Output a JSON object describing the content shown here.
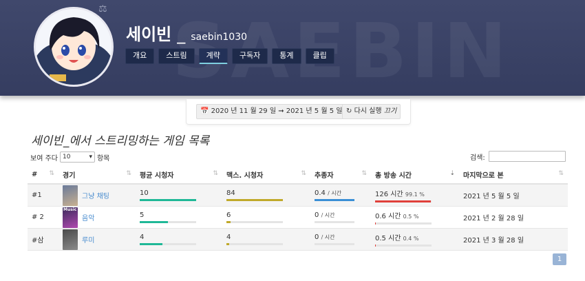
{
  "header": {
    "bg_watermark": "SAEBIN",
    "display_name": "세이빈",
    "separator": "_",
    "login": "saebin1030",
    "tabs": [
      "개요",
      "스트림",
      "계략",
      "구독자",
      "통계",
      "클립"
    ],
    "active_tab": 2
  },
  "date_range": {
    "label": "2020 년 11 월 29 일 ➞ 2021 년 5 월 5 일",
    "refresh_label": "다시 실행",
    "off_label": "끄기"
  },
  "section_title": "세이빈_에서 스트리밍하는 게임 목록",
  "length": {
    "prefix": "보여 주다",
    "value": "10",
    "suffix": "항목"
  },
  "search": {
    "label": "검색:",
    "value": ""
  },
  "table": {
    "headers": [
      "#",
      "경기",
      "평균 시청자",
      "맥스. 시청자",
      "추종자",
      "총 방송 시간",
      "마지막으로 본"
    ],
    "rows": [
      {
        "rank": "#1",
        "game": "그냥 채팅",
        "avg": "10",
        "avg_pct": 1.0,
        "max": "84",
        "max_pct": 1.0,
        "followers": "0.4",
        "followers_unit": "/ 시간",
        "followers_pct": 1.0,
        "hours": "126 시간",
        "hours_pct_text": "99.1 %",
        "hours_pct": 0.991,
        "last": "2021 년 5 월 5 일"
      },
      {
        "rank": "# 2",
        "game": "음악",
        "avg": "5",
        "avg_pct": 0.5,
        "max": "6",
        "max_pct": 0.07,
        "followers": "0",
        "followers_unit": "/ 시간",
        "followers_pct": 0.0,
        "hours": "0.6 시간",
        "hours_pct_text": "0.5 %",
        "hours_pct": 0.005,
        "last": "2021 년 2 월 28 일"
      },
      {
        "rank": "#삼",
        "game": "루미",
        "avg": "4",
        "avg_pct": 0.4,
        "max": "4",
        "max_pct": 0.05,
        "followers": "0",
        "followers_unit": "/ 시간",
        "followers_pct": 0.0,
        "hours": "0.5 시간",
        "hours_pct_text": "0.4 %",
        "hours_pct": 0.004,
        "last": "2021 년 3 월 28 일"
      }
    ],
    "thumb_music_label": "Music"
  },
  "colors": {
    "avg": "#1fb897",
    "max": "#c0a92a",
    "followers": "#3a8fd6",
    "hours": "#e0403a"
  },
  "pager": {
    "current": "1"
  }
}
